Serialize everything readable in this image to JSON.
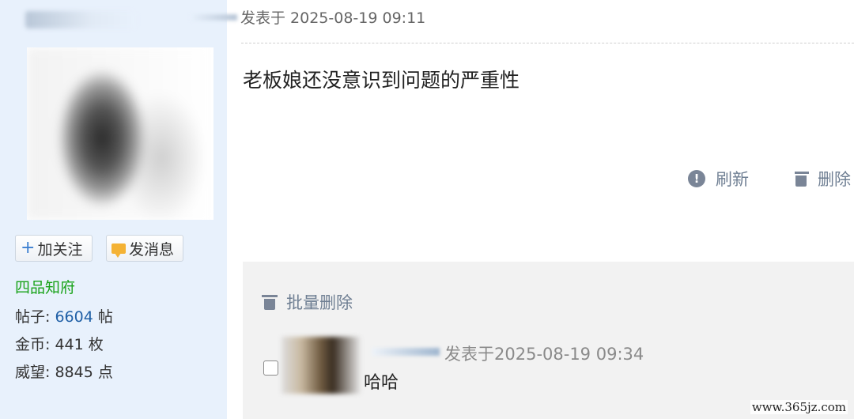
{
  "sidebar": {
    "follow_label": "加关注",
    "message_label": "发消息",
    "rank": "四品知府",
    "posts_label": "帖子:",
    "posts_value": "6604",
    "posts_unit": "帖",
    "gold_label": "金币:",
    "gold_value": "441",
    "gold_unit": "枚",
    "prestige_label": "威望:",
    "prestige_value": "8845",
    "prestige_unit": "点"
  },
  "post": {
    "time": "发表于 2025-08-19 09:11",
    "body": "老板娘还没意识到问题的严重性",
    "actions": {
      "refresh": "刷新",
      "delete": "删除"
    }
  },
  "replies": {
    "batch_delete": "批量删除",
    "items": [
      {
        "time": "发表于2025-08-19 09:34",
        "text": "哈哈"
      }
    ]
  },
  "watermark": "www.365jz.com",
  "colors": {
    "rank": "#18a218",
    "link_number": "#1f5fa6",
    "sidebar_bg": "#e8f1fc",
    "panel_bg": "#f2f2f2",
    "action_gray": "#6f7f93"
  },
  "icons": [
    "plus-icon",
    "message-icon",
    "info-icon",
    "trash-icon"
  ]
}
